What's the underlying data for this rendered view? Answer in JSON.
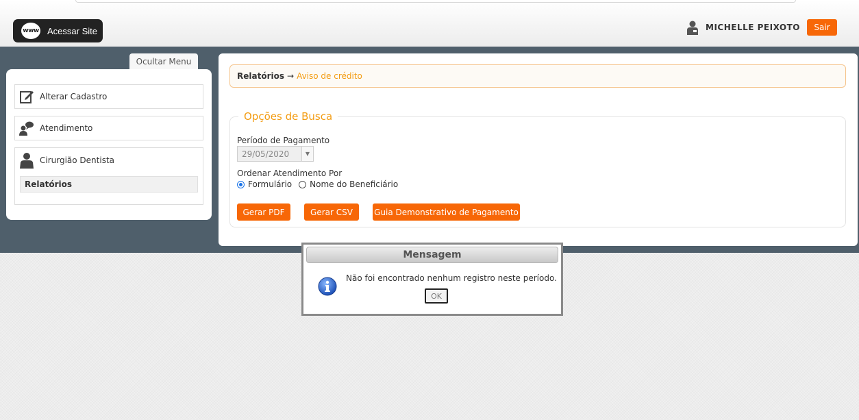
{
  "header": {
    "site_button_icon_text": "www",
    "site_button_label": "Acessar Site",
    "user_name": "MICHELLE PEIXOTO",
    "logout_label": "Sair"
  },
  "sidebar": {
    "toggle_label": "Ocultar Menu",
    "items": [
      {
        "label": "Alterar Cadastro",
        "icon": "edit-icon"
      },
      {
        "label": "Atendimento",
        "icon": "chat-user-icon"
      },
      {
        "label": "Cirurgião Dentista",
        "icon": "user-icon",
        "subitems": [
          {
            "label": "Relatórios"
          }
        ]
      }
    ]
  },
  "breadcrumb": {
    "root": "Relatórios",
    "separator": "→",
    "current": "Aviso de crédito"
  },
  "search": {
    "legend": "Opções de Busca",
    "period_label": "Período de Pagamento",
    "period_value": "29/05/2020",
    "order_label": "Ordenar Atendimento Por",
    "order_options": [
      {
        "label": "Formulário",
        "checked": true
      },
      {
        "label": "Nome do Beneficiário",
        "checked": false
      }
    ],
    "buttons": {
      "pdf": "Gerar PDF",
      "csv": "Gerar CSV",
      "guide": "Guia Demonstrativo de Pagamento"
    }
  },
  "dialog": {
    "title": "Mensagem",
    "message": "Não foi encontrado nenhum registro neste período.",
    "ok_label": "OK",
    "icon": "info-icon"
  },
  "colors": {
    "accent_orange": "#f76707",
    "link_orange": "#f39c12",
    "band": "#4f5f6b"
  }
}
